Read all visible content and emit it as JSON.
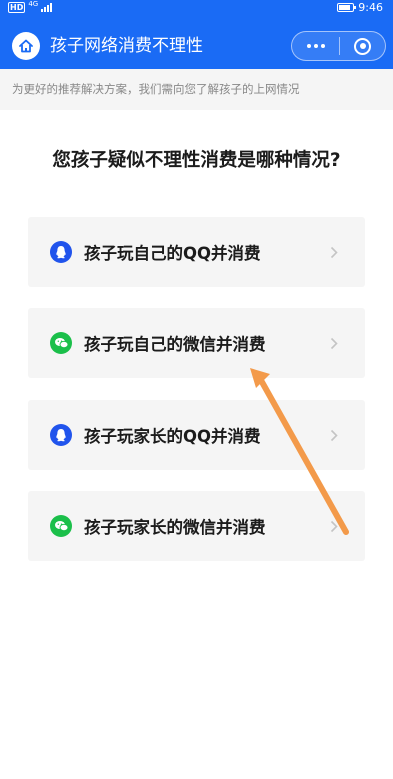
{
  "status_bar": {
    "hd": "HD",
    "network": "4G",
    "time": "9:46",
    "battery_level": 0.85
  },
  "nav": {
    "title": "孩子网络消费不理性",
    "home_icon": "home-icon",
    "more_icon": "more-dots-icon",
    "close_icon": "target-close-icon"
  },
  "hint": "为更好的推荐解决方案，我们需向您了解孩子的上网情况",
  "question": "您孩子疑似不理性消费是哪种情况?",
  "options": [
    {
      "label": "孩子玩自己的QQ并消费",
      "icon": "qq-icon"
    },
    {
      "label": "孩子玩自己的微信并消费",
      "icon": "wechat-icon"
    },
    {
      "label": "孩子玩家长的QQ并消费",
      "icon": "qq-icon"
    },
    {
      "label": "孩子玩家长的微信并消费",
      "icon": "wechat-icon"
    }
  ],
  "colors": {
    "nav_bg": "#1a6bf5",
    "qq": "#2154ec",
    "wechat": "#1bbf4a",
    "annotation_arrow": "#f39a4a"
  }
}
